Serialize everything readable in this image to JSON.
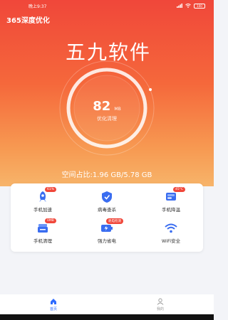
{
  "status_bar": {
    "time": "晚上9:37",
    "battery": "100"
  },
  "app": {
    "title": "365深度优化"
  },
  "watermark": "五九软件",
  "gauge": {
    "value": "82",
    "unit": "MB",
    "subtitle": "优化清理"
  },
  "storage": {
    "text": "空间占比:1.96 GB/5.78 GB"
  },
  "tools": [
    {
      "label": "手机加速",
      "badge": "61%",
      "icon": "rocket-icon"
    },
    {
      "label": "病毒查杀",
      "badge": "",
      "icon": "shield-icon"
    },
    {
      "label": "手机降温",
      "badge": "45°C",
      "icon": "thermometer-icon"
    },
    {
      "label": "手机清理",
      "badge": "0MB",
      "icon": "broom-icon"
    },
    {
      "label": "强力省电",
      "badge": "耗电检测",
      "icon": "battery-icon"
    },
    {
      "label": "WiFi安全",
      "badge": "",
      "icon": "wifi-icon"
    }
  ],
  "tabbar": {
    "tabs": [
      {
        "label": "首页",
        "icon": "home-icon"
      },
      {
        "label": "我的",
        "icon": "user-icon"
      }
    ]
  },
  "colors": {
    "hero_top": "#f0473a",
    "hero_bottom": "#f7b46a",
    "accent_blue": "#2e6bff",
    "badge_red": "#f0473a"
  }
}
